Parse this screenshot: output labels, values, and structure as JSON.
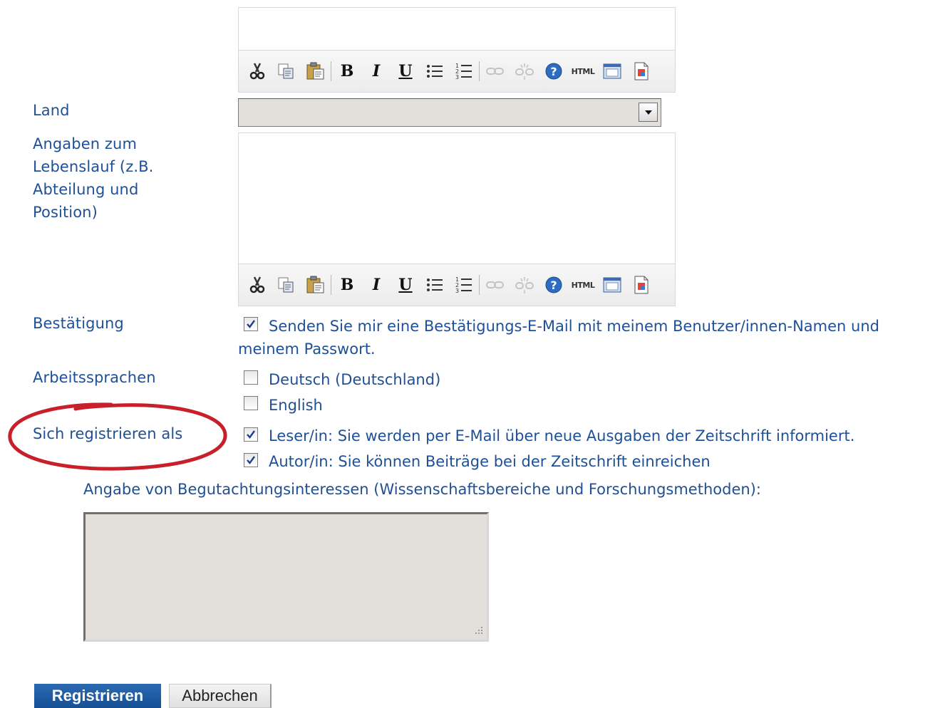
{
  "form": {
    "land_label": "Land",
    "land_value": "",
    "bio_label": "Angaben zum Lebenslauf (z.B. Abteilung und Position)",
    "confirm_label": "Bestätigung",
    "confirm_text": "Senden Sie mir eine Bestätigungs-E-Mail mit meinem Benutzer/innen-Namen und meinem Passwort.",
    "confirm_checked": true,
    "languages_label": "Arbeitssprachen",
    "languages": [
      {
        "label": "Deutsch (Deutschland)",
        "checked": false
      },
      {
        "label": "English",
        "checked": false
      }
    ],
    "register_as_label": "Sich registrieren als",
    "roles": [
      {
        "label": "Leser/in: Sie werden per E-Mail über neue Ausgaben der Zeitschrift informiert.",
        "checked": true
      },
      {
        "label": "Autor/in: Sie können Beiträge bei der Zeitschrift einreichen",
        "checked": true
      }
    ],
    "review_interests_label": "Angabe von Begutachtungsinteressen (Wissenschaftsbereiche und Forschungsmethoden):",
    "review_interests_value": ""
  },
  "toolbar_icons": [
    "cut-icon",
    "copy-icon",
    "paste-icon",
    "bold-icon",
    "italic-icon",
    "underline-icon",
    "bullet-list-icon",
    "numbered-list-icon",
    "link-icon",
    "unlink-icon",
    "help-icon",
    "html-icon",
    "fullscreen-icon",
    "image-icon"
  ],
  "toolbar_text": {
    "bold": "B",
    "italic": "I",
    "underline": "U",
    "html": "HTML"
  },
  "buttons": {
    "submit": "Registrieren",
    "cancel": "Abbrechen"
  },
  "colors": {
    "text": "#1f4f95",
    "primary_button": "#1d5aa3",
    "annotation_circle": "#c8202a"
  }
}
